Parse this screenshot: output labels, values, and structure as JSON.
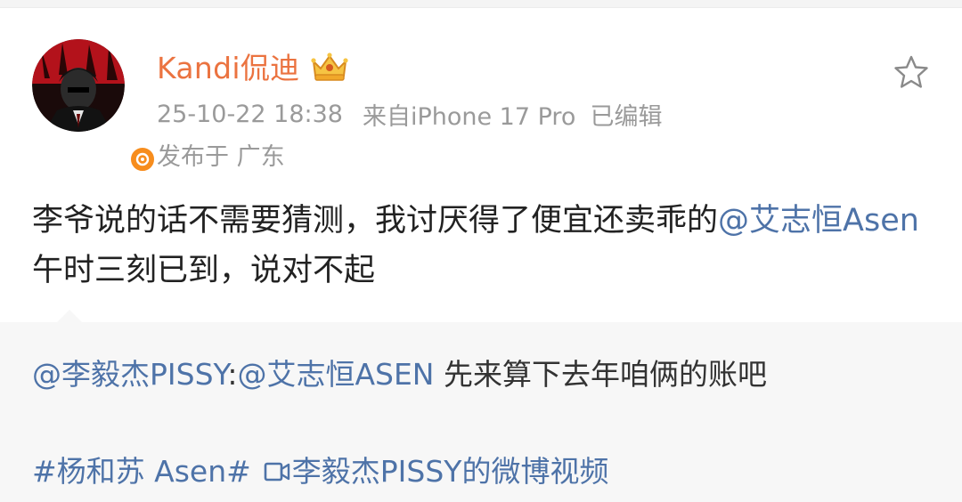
{
  "post": {
    "author": {
      "name": "Kandi侃迪",
      "avatar_icon": "avatar-icon",
      "verified_icon": "verified-badge-icon",
      "member_icon": "crown-member-icon"
    },
    "timestamp": "25-10-22 18:38",
    "source": "来自iPhone 17 Pro",
    "edited": "已编辑",
    "location": "发布于 广东",
    "text_part1": "李爷说的话不需要猜测，我讨厌得了便宜还卖乖的",
    "mention_1": "@艾志恒Asen",
    "text_part2": " 午时三刻已到，说对不起",
    "favorite_icon": "star-icon"
  },
  "repost": {
    "mention_author": "@李毅杰PISSY",
    "colon": ":",
    "mention_2": "@艾志恒ASEN",
    "text": " 先来算下去年咱俩的账吧",
    "hashtag": "#杨和苏 Asen#",
    "video_icon": "video-icon",
    "video_link": "李毅杰PISSY的微博视频"
  },
  "colors": {
    "username": "#eb7340",
    "link": "#4e73a8",
    "meta": "#9a9a9a",
    "verified": "#f78d1d",
    "repost_bg": "#f7f7f7"
  }
}
